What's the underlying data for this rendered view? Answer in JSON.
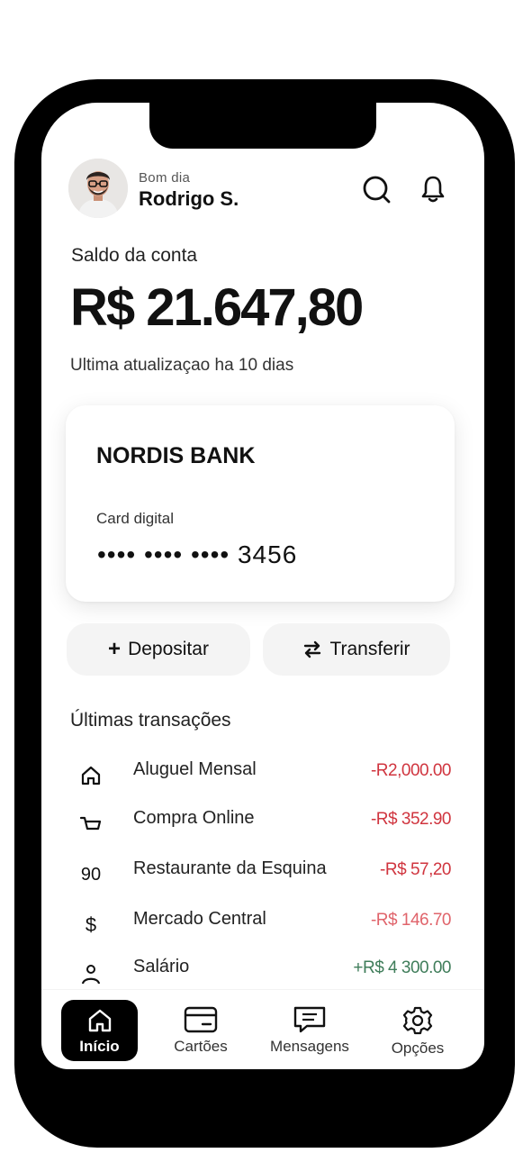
{
  "header": {
    "greeting": "Bom dia",
    "user_name": "Rodrigo S."
  },
  "balance": {
    "label": "Saldo da conta",
    "value": "R$ 21.647,80",
    "last_update": "Ultima atualizaçao ha 10 dias"
  },
  "card": {
    "bank_name": "NORDIS BANK",
    "type": "Card digital",
    "number_masked": "•••• ••••  •••• 3456"
  },
  "actions": {
    "deposit_label": "Depositar",
    "transfer_label": "Transferir"
  },
  "transactions": {
    "title": "Últimas transações",
    "items": [
      {
        "icon": "home-icon",
        "icon_text": "",
        "name": "Aluguel Mensal",
        "amount": "-R2,000.00",
        "color": "#d0353f"
      },
      {
        "icon": "cart-icon",
        "icon_text": "",
        "name": "Compra Online",
        "amount": "-R$ 352.90",
        "color": "#d0353f"
      },
      {
        "icon": "number-icon",
        "icon_text": "90",
        "name": "Restaurante da Esquina",
        "amount": "-R$ 57,20",
        "color": "#d0353f"
      },
      {
        "icon": "dollar-icon",
        "icon_text": "$",
        "name": "Mercado Central",
        "amount": "-R$ 146.70",
        "color": "#e0646b"
      },
      {
        "icon": "person-icon",
        "icon_text": "",
        "name": "Salário",
        "amount": "+R$ 4 300.00",
        "color": "#3f7d5a"
      }
    ]
  },
  "nav": {
    "items": [
      {
        "label": "Início",
        "icon": "home-icon",
        "active": true
      },
      {
        "label": "Cartões",
        "icon": "card-icon",
        "active": false
      },
      {
        "label": "Mensagens",
        "icon": "message-icon",
        "active": false
      },
      {
        "label": "Opções",
        "icon": "gear-icon",
        "active": false
      }
    ]
  },
  "colors": {
    "negative": "#d0353f",
    "positive": "#3f7d5a",
    "frame": "#000000"
  }
}
